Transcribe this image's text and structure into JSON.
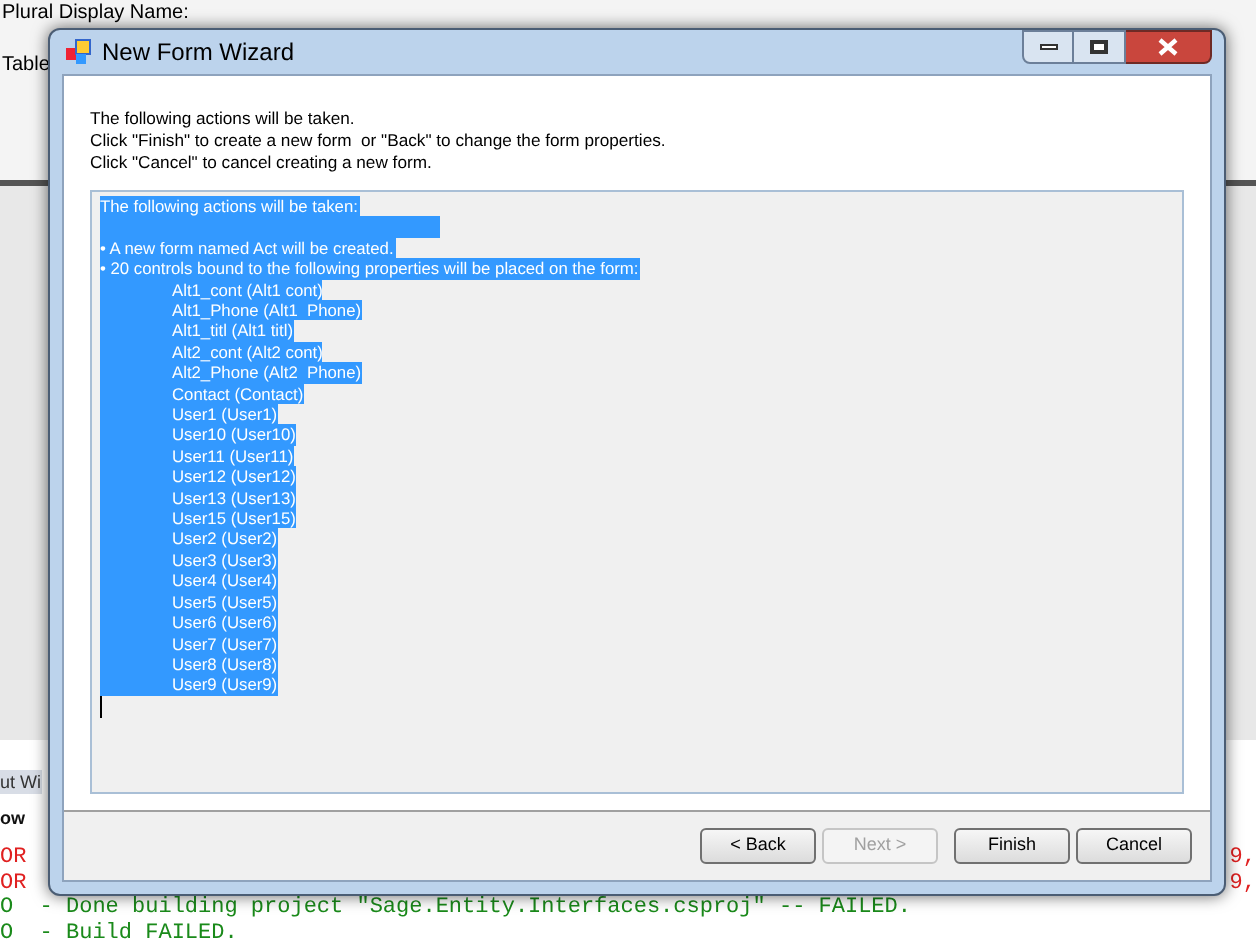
{
  "background": {
    "labels": [
      "Plural Display Name:",
      "Table"
    ],
    "side_labels": [
      "ut Wi",
      "ow"
    ],
    "output_lines": [
      {
        "kind": "error",
        "prefix": "OR",
        "suffix": "9,"
      },
      {
        "kind": "error",
        "prefix": "OR",
        "suffix": "9,"
      },
      {
        "kind": "info",
        "prefix": "O",
        "text": "- Done building project \"Sage.Entity.Interfaces.csproj\" -- FAILED."
      },
      {
        "kind": "info",
        "prefix": "O",
        "text": "- Build FAILED."
      }
    ]
  },
  "dialog": {
    "title": "New Form Wizard",
    "instructions": [
      "The following actions will be taken.",
      "Click \"Finish\" to create a new form  or \"Back\" to change the form properties.",
      "Click \"Cancel\" to cancel creating a new form."
    ],
    "summary": {
      "heading": "The following actions will be taken:",
      "bullets": [
        "• A new form named Act will be created.",
        "• 20 controls bound to the following properties will be placed on the form:"
      ],
      "properties": [
        "Alt1_cont (Alt1 cont)",
        "Alt1_Phone (Alt1  Phone)",
        "Alt1_titl (Alt1 titl)",
        "Alt2_cont (Alt2 cont)",
        "Alt2_Phone (Alt2  Phone)",
        "Contact (Contact)",
        "User1 (User1)",
        "User10 (User10)",
        "User11 (User11)",
        "User12 (User12)",
        "User13 (User13)",
        "User15 (User15)",
        "User2 (User2)",
        "User3 (User3)",
        "User4 (User4)",
        "User5 (User5)",
        "User6 (User6)",
        "User7 (User7)",
        "User8 (User8)",
        "User9 (User9)"
      ]
    },
    "buttons": [
      {
        "label": "< Back",
        "disabled": false
      },
      {
        "label": "Next >",
        "disabled": true
      },
      {
        "label": "Finish",
        "disabled": false
      },
      {
        "label": "Cancel",
        "disabled": false
      }
    ]
  }
}
